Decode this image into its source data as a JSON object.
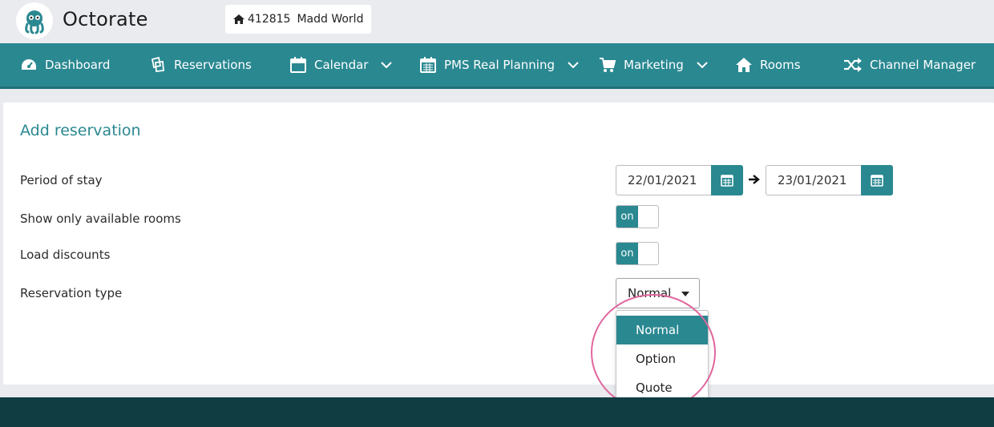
{
  "header": {
    "brand": "Octorate",
    "property_id": "412815",
    "property_name": "Madd World"
  },
  "nav": {
    "items": [
      {
        "label": "Dashboard",
        "icon": "dashboard-icon"
      },
      {
        "label": "Reservations",
        "icon": "reservations-icon"
      },
      {
        "label": "Calendar",
        "icon": "calendar-icon",
        "dropdown": true
      },
      {
        "label": "PMS Real Planning",
        "icon": "planning-calendar-icon",
        "dropdown": true
      },
      {
        "label": "Marketing",
        "icon": "cart-icon",
        "dropdown": true
      },
      {
        "label": "Rooms",
        "icon": "home-icon"
      },
      {
        "label": "Channel Manager",
        "icon": "shuffle-icon"
      }
    ]
  },
  "form": {
    "title": "Add reservation",
    "period_label": "Period of stay",
    "date_from": "22/01/2021",
    "date_to": "23/01/2021",
    "available_rooms_label": "Show only available rooms",
    "available_rooms_toggle": "on",
    "load_discounts_label": "Load discounts",
    "load_discounts_toggle": "on",
    "reservation_type_label": "Reservation type",
    "reservation_type_value": "Normal",
    "reservation_type_options": [
      "Normal",
      "Option",
      "Quote"
    ]
  },
  "colors": {
    "accent": "#2a8891",
    "footer": "#0f3d42",
    "highlight_ring": "#e0669d"
  }
}
